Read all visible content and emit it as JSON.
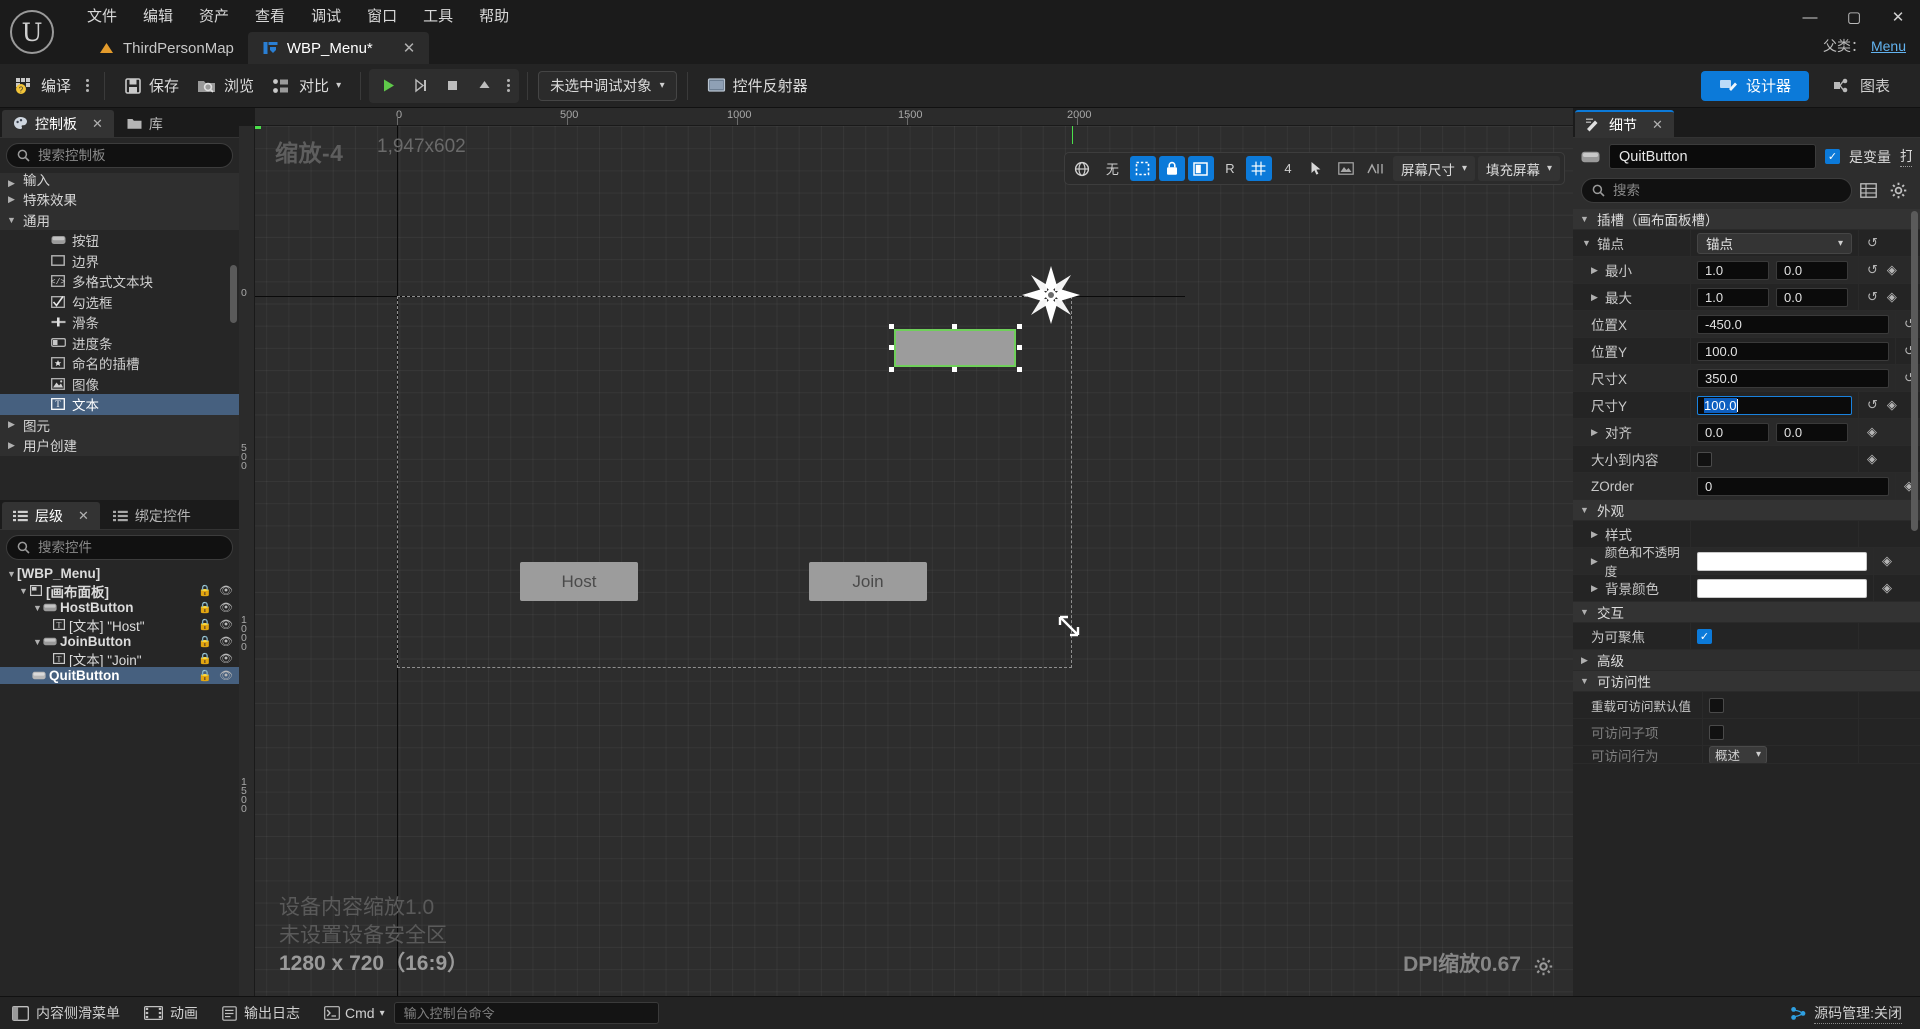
{
  "window": {
    "menu": [
      "文件",
      "编辑",
      "资产",
      "查看",
      "调试",
      "窗口",
      "工具",
      "帮助"
    ],
    "tabs": [
      {
        "label": "ThirdPersonMap",
        "icon": "map-icon",
        "active": false
      },
      {
        "label": "WBP_Menu*",
        "icon": "widget-blueprint-icon",
        "active": true
      }
    ],
    "controls": {
      "minimize": "—",
      "maximize": "▢",
      "close": "✕"
    },
    "parent_class_label": "父类：",
    "parent_class_value": "Menu"
  },
  "toolbar": {
    "compile": "编译",
    "save": "保存",
    "browse": "浏览",
    "diff": "对比",
    "play_tooltip": "play-icon",
    "debug_object": "未选中调试对象",
    "widget_reflector": "控件反射器",
    "designer": "设计器",
    "graph": "图表"
  },
  "palette": {
    "tabs": [
      {
        "label": "控制板",
        "active": true,
        "closable": true
      },
      {
        "label": "库",
        "active": false,
        "closable": false
      }
    ],
    "search_placeholder": "搜索控制板",
    "search_value": "",
    "rows": [
      {
        "label": "输入",
        "type": "category",
        "expanded": false
      },
      {
        "label": "特殊效果",
        "type": "category",
        "expanded": false
      },
      {
        "label": "通用",
        "type": "category",
        "expanded": true
      },
      {
        "label": "按钮",
        "type": "item",
        "icon": "button-icon"
      },
      {
        "label": "边界",
        "type": "item",
        "icon": "border-icon"
      },
      {
        "label": "多格式文本块",
        "type": "item",
        "icon": "richtext-icon"
      },
      {
        "label": "勾选框",
        "type": "item",
        "icon": "checkbox-icon"
      },
      {
        "label": "滑条",
        "type": "item",
        "icon": "slider-icon"
      },
      {
        "label": "进度条",
        "type": "item",
        "icon": "progressbar-icon"
      },
      {
        "label": "命名的插槽",
        "type": "item",
        "icon": "namedslot-icon"
      },
      {
        "label": "图像",
        "type": "item",
        "icon": "image-icon"
      },
      {
        "label": "文本",
        "type": "item",
        "icon": "text-icon",
        "selected": true
      },
      {
        "label": "图元",
        "type": "category",
        "expanded": false
      },
      {
        "label": "用户创建",
        "type": "category",
        "expanded": false
      }
    ]
  },
  "hierarchy": {
    "tabs": [
      {
        "label": "层级",
        "active": true,
        "closable": true
      },
      {
        "label": "绑定控件",
        "active": false,
        "closable": false
      }
    ],
    "search_placeholder": "搜索控件",
    "search_value": "",
    "nodes": [
      {
        "label": "[WBP_Menu]",
        "depth": 0,
        "expander": "down",
        "icon": "",
        "bold": true,
        "locks": false
      },
      {
        "label": "[画布面板]",
        "depth": 1,
        "expander": "down",
        "icon": "canvas-panel-icon",
        "bold": true,
        "locks": true
      },
      {
        "label": "HostButton",
        "depth": 2,
        "expander": "down",
        "icon": "button-icon",
        "bold": true,
        "locks": true
      },
      {
        "label": "[文本] \"Host\"",
        "depth": 3,
        "expander": "none",
        "icon": "text-icon",
        "bold": false,
        "locks": true
      },
      {
        "label": "JoinButton",
        "depth": 2,
        "expander": "down",
        "icon": "button-icon",
        "bold": true,
        "locks": true
      },
      {
        "label": "[文本] \"Join\"",
        "depth": 3,
        "expander": "none",
        "icon": "text-icon",
        "bold": false,
        "locks": true
      },
      {
        "label": "QuitButton",
        "depth": 2,
        "expander": "none",
        "icon": "button-icon",
        "bold": true,
        "locks": true,
        "selected": true
      }
    ]
  },
  "viewport": {
    "zoom_label": "缩放-4",
    "resolution_label": "1,947x602",
    "ruler_top_ticks": [
      "0",
      "500",
      "1000",
      "1500",
      "2000"
    ],
    "ruler_left_ticks": [
      "0",
      "500",
      "1000",
      "1500"
    ],
    "device_scale_line": "设备内容缩放1.0",
    "safe_zone_line": "未设置设备安全区",
    "preview_size_line": "1280 x 720（16:9）",
    "dpi_label": "DPI缩放0.67",
    "toolbar": {
      "locale": "无",
      "grid_snap_value": "4",
      "r_label": "R",
      "screen_size": "屏幕尺寸",
      "fill_screen": "填充屏幕"
    },
    "widgets": [
      {
        "name": "HostButton",
        "label": "Host",
        "selected": false
      },
      {
        "name": "JoinButton",
        "label": "Join",
        "selected": false
      },
      {
        "name": "QuitButton",
        "label": "",
        "selected": true
      }
    ]
  },
  "details": {
    "tab_label": "细节",
    "widget_name": "QuitButton",
    "is_variable_label": "是变量",
    "is_variable_checked": true,
    "open_button_link": "打开Button",
    "search_placeholder": "搜索",
    "search_value": "",
    "sections": [
      {
        "title": "插槽（画布面板槽）",
        "expanded": true,
        "rows": [
          {
            "label": "锚点",
            "kind": "combo",
            "value": "锚点",
            "expander": "down",
            "reset": true
          },
          {
            "label": "最小",
            "kind": "vec2",
            "values": [
              "1.0",
              "0.0"
            ],
            "expander": "right",
            "indent": 1,
            "reset": true
          },
          {
            "label": "最大",
            "kind": "vec2",
            "values": [
              "1.0",
              "0.0"
            ],
            "expander": "right",
            "indent": 1,
            "reset": true
          },
          {
            "label": "位置X",
            "kind": "num",
            "value": "-450.0",
            "reset": true
          },
          {
            "label": "位置Y",
            "kind": "num",
            "value": "100.0",
            "reset": true
          },
          {
            "label": "尺寸X",
            "kind": "num",
            "value": "350.0",
            "reset": true
          },
          {
            "label": "尺寸Y",
            "kind": "num",
            "value": "100.0",
            "focused": true,
            "reset": true
          },
          {
            "label": "对齐",
            "kind": "vec2",
            "values": [
              "0.0",
              "0.0"
            ],
            "expander": "right",
            "reset": false
          },
          {
            "label": "大小到内容",
            "kind": "checkbox",
            "checked": false
          },
          {
            "label": "ZOrder",
            "kind": "num",
            "value": "0",
            "reset": false
          }
        ]
      },
      {
        "title": "外观",
        "expanded": true,
        "rows": [
          {
            "label": "样式",
            "kind": "blank",
            "expander": "right"
          },
          {
            "label": "颜色和不透明度",
            "kind": "color",
            "color": "#ffffff",
            "expander": "right"
          },
          {
            "label": "背景颜色",
            "kind": "color",
            "color": "#ffffff",
            "expander": "right"
          }
        ]
      },
      {
        "title": "交互",
        "expanded": true,
        "rows": [
          {
            "label": "为可聚焦",
            "kind": "checkbox",
            "checked": true
          },
          {
            "label": "高级",
            "kind": "subgroup",
            "expander": "right"
          }
        ]
      },
      {
        "title": "可访问性",
        "expanded": true,
        "rows": [
          {
            "label": "重载可访问默认值",
            "kind": "checkbox",
            "checked": false
          },
          {
            "label": "可访问子项",
            "kind": "checkbox",
            "checked": false,
            "dim": true
          },
          {
            "label": "可访问行为",
            "kind": "combo-sm",
            "value": "概述",
            "dim": true
          }
        ]
      }
    ]
  },
  "statusbar": {
    "content_drawer": "内容侧滑菜单",
    "animation": "动画",
    "output_log": "输出日志",
    "cmd_label": "Cmd",
    "cmd_placeholder": "输入控制台命令",
    "cmd_value": "",
    "source_control": "源码管理:关闭"
  },
  "colors": {
    "accent_blue": "#0c7ad9",
    "selection_blue": "#46607f",
    "selection_green": "#6fcf5a",
    "panel_bg": "#262626",
    "canvas_bg": "#2d2d2d",
    "widget_gray": "#9c9c9c"
  }
}
